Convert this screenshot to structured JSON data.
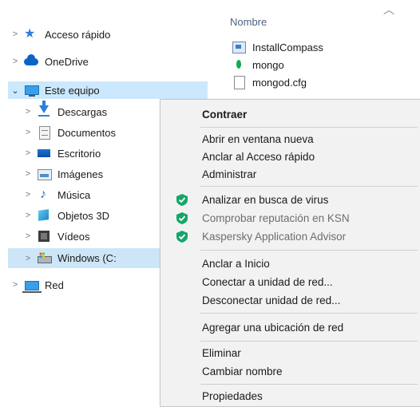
{
  "nav": {
    "items": [
      {
        "label": "Acceso rápido",
        "icon": "star-icon"
      },
      {
        "label": "OneDrive",
        "icon": "cloud-icon"
      },
      {
        "label": "Este equipo",
        "icon": "computer-icon"
      },
      {
        "label": "Descargas",
        "icon": "downloads-icon"
      },
      {
        "label": "Documentos",
        "icon": "documents-icon"
      },
      {
        "label": "Escritorio",
        "icon": "desktop-icon"
      },
      {
        "label": "Imágenes",
        "icon": "pictures-icon"
      },
      {
        "label": "Música",
        "icon": "music-icon"
      },
      {
        "label": "Objetos 3D",
        "icon": "objects3d-icon"
      },
      {
        "label": "Vídeos",
        "icon": "videos-icon"
      },
      {
        "label": "Windows (C:",
        "icon": "drive-icon"
      },
      {
        "label": "Red",
        "icon": "network-icon"
      }
    ]
  },
  "files": {
    "header": "Nombre",
    "items": [
      {
        "name": "InstallCompass",
        "icon": "installer-icon"
      },
      {
        "name": "mongo",
        "icon": "mongodb-leaf-icon"
      },
      {
        "name": "mongod.cfg",
        "icon": "file-icon"
      }
    ]
  },
  "menu": {
    "items": [
      {
        "label": "Contraer"
      },
      {
        "label": "Abrir en ventana nueva"
      },
      {
        "label": "Anclar al Acceso rápido"
      },
      {
        "label": "Administrar"
      },
      {
        "label": "Analizar en busca de virus"
      },
      {
        "label": "Comprobar reputación en KSN"
      },
      {
        "label": "Kaspersky Application Advisor"
      },
      {
        "label": "Anclar a Inicio"
      },
      {
        "label": "Conectar a unidad de red..."
      },
      {
        "label": "Desconectar unidad de red..."
      },
      {
        "label": "Agregar una ubicación de red"
      },
      {
        "label": "Eliminar"
      },
      {
        "label": "Cambiar nombre"
      },
      {
        "label": "Propiedades"
      }
    ]
  },
  "colors": {
    "selection": "#cce8ff",
    "menu_bg": "#f2f2f2",
    "kaspersky_green": "#16a56a",
    "header_text": "#4d6380"
  }
}
